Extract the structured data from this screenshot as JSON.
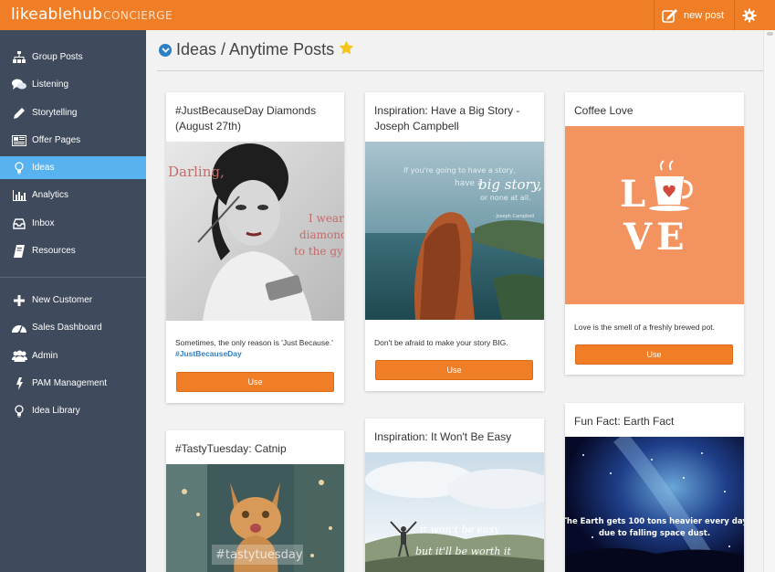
{
  "app": {
    "logo_main": "likeablehub",
    "logo_sub": "CONCIERGE",
    "new_post_label": "new post"
  },
  "sidebar": {
    "items": [
      {
        "label": "Group Posts",
        "icon": "sitemap-icon"
      },
      {
        "label": "Listening",
        "icon": "chat-bubbles-icon"
      },
      {
        "label": "Storytelling",
        "icon": "pencil-icon"
      },
      {
        "label": "Offer Pages",
        "icon": "newspaper-icon"
      },
      {
        "label": "Ideas",
        "icon": "lightbulb-icon",
        "active": true
      },
      {
        "label": "Analytics",
        "icon": "bar-chart-icon"
      },
      {
        "label": "Inbox",
        "icon": "inbox-icon"
      },
      {
        "label": "Resources",
        "icon": "book-icon"
      }
    ],
    "admin_items": [
      {
        "label": "New Customer",
        "icon": "plus-icon"
      },
      {
        "label": "Sales Dashboard",
        "icon": "dashboard-icon"
      },
      {
        "label": "Admin",
        "icon": "users-icon"
      },
      {
        "label": "PAM Management",
        "icon": "bolt-icon"
      },
      {
        "label": "Idea Library",
        "icon": "lightbulb-icon"
      }
    ]
  },
  "page": {
    "title": "Ideas / Anytime Posts"
  },
  "cards": [
    {
      "title": "#JustBecauseDay Diamonds (August 27th)",
      "image": "vintage woman with diamond ring",
      "image_words": [
        "Darling,",
        "I wear",
        "diamond",
        "to the gy"
      ],
      "text": "Sometimes, the only reason is 'Just Because.'",
      "tag": "#JustBecauseDay",
      "button": "Use"
    },
    {
      "title": "Inspiration: Have a Big Story - Joseph Campbell",
      "image": "woman looking at ocean coast",
      "image_words": [
        "If you're going to have a story,",
        "have a",
        "big story,",
        "or none at all.",
        "- Joseph Campbell"
      ],
      "text": "Don't be afraid to make your story BIG.",
      "button": "Use"
    },
    {
      "title": "Coffee Love",
      "image": "LOVE with coffee cup",
      "image_words": [
        "L",
        "V",
        "E"
      ],
      "text": "Love is the smell of a freshly brewed pot.",
      "button": "Use"
    },
    {
      "title": "#TastyTuesday: Catnip",
      "image": "tabby cat",
      "image_words": [
        "#tastytuesday"
      ]
    },
    {
      "title": "Inspiration: It Won't Be Easy",
      "image": "hiker on mountain top",
      "image_words": [
        "it won't be easy",
        "but it'll be worth it"
      ]
    },
    {
      "title": "Fun Fact: Earth Fact",
      "image": "starry sky over earth",
      "image_words": [
        "The Earth gets 100 tons heavier every day",
        "due to falling space dust."
      ]
    }
  ],
  "colors": {
    "brand_orange": "#f07e26",
    "sidebar_bg": "#3f4a5c",
    "active_blue": "#59b2f0",
    "link_blue": "#2f7fc4"
  }
}
